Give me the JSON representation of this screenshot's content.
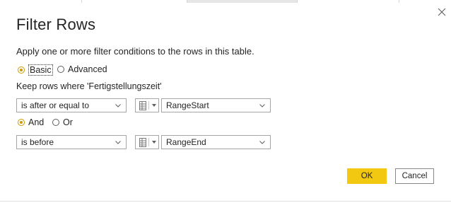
{
  "dialog": {
    "title": "Filter Rows",
    "description": "Apply one or more filter conditions to the rows in this table.",
    "mode_basic_label": "Basic",
    "mode_advanced_label": "Advanced",
    "selected_mode": "Basic",
    "keep_rows_label": "Keep rows where 'Fertigstellungszeit'"
  },
  "conditions": [
    {
      "operator": "is after or equal to",
      "value_type_icon": "table-icon",
      "value": "RangeStart"
    },
    {
      "operator": "is before",
      "value_type_icon": "table-icon",
      "value": "RangeEnd"
    }
  ],
  "logic": {
    "and_label": "And",
    "or_label": "Or",
    "selected": "And"
  },
  "buttons": {
    "ok_label": "OK",
    "cancel_label": "Cancel"
  },
  "colors": {
    "accent": "#f2c811",
    "radio_selected": "#c69b00"
  }
}
